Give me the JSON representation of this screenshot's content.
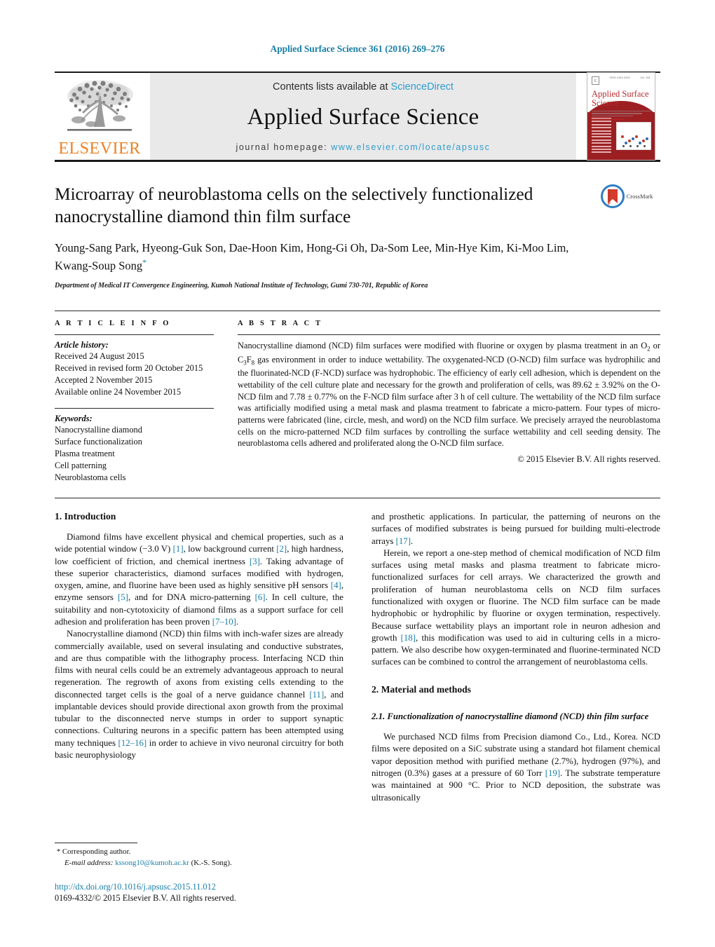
{
  "running_head": "Applied Surface Science 361 (2016) 269–276",
  "masthead": {
    "publisher_name": "ELSEVIER",
    "contents_prefix": "Contents lists available at",
    "contents_link": "ScienceDirect",
    "journal_title": "Applied Surface Science",
    "homepage_prefix": "journal homepage:",
    "homepage_url": "www.elsevier.com/locate/apsusc",
    "cover": {
      "journal_name": "Applied Surface Science",
      "top_left_code": "ISSN 0169-4332",
      "top_right_code": "Vol. 361"
    }
  },
  "article": {
    "title": "Microarray of neuroblastoma cells on the selectively functionalized nanocrystalline diamond thin film surface",
    "authors": "Young-Sang Park, Hyeong-Guk Son, Dae-Hoon Kim, Hong-Gi Oh, Da-Som Lee, Min-Hye Kim, Ki-Moo Lim, Kwang-Soup Song",
    "corresponding_marker": "*",
    "affiliation": "Department of Medical IT Convergence Engineering, Kumoh National Institute of Technology, Gumi 730-701, Republic of Korea",
    "crossmark_label": "CrossMark"
  },
  "info": {
    "heading": "A R T I C L E   I N F O",
    "history_label": "Article history:",
    "history": [
      "Received 24 August 2015",
      "Received in revised form 20 October 2015",
      "Accepted 2 November 2015",
      "Available online 24 November 2015"
    ],
    "keywords_label": "Keywords:",
    "keywords": [
      "Nanocrystalline diamond",
      "Surface functionalization",
      "Plasma treatment",
      "Cell patterning",
      "Neuroblastoma cells"
    ]
  },
  "abstract": {
    "heading": "A B S T R A C T",
    "text": "Nanocrystalline diamond (NCD) film surfaces were modified with fluorine or oxygen by plasma treatment in an O2 or C3F8 gas environment in order to induce wettability. The oxygenated-NCD (O-NCD) film surface was hydrophilic and the fluorinated-NCD (F-NCD) surface was hydrophobic. The efficiency of early cell adhesion, which is dependent on the wettability of the cell culture plate and necessary for the growth and proliferation of cells, was 89.62 ± 3.92% on the O-NCD film and 7.78 ± 0.77% on the F-NCD film surface after 3 h of cell culture. The wettability of the NCD film surface was artificially modified using a metal mask and plasma treatment to fabricate a micro-pattern. Four types of micro-patterns were fabricated (line, circle, mesh, and word) on the NCD film surface. We precisely arrayed the neuroblastoma cells on the micro-patterned NCD film surfaces by controlling the surface wettability and cell seeding density. The neuroblastoma cells adhered and proliferated along the O-NCD film surface.",
    "copyright": "© 2015 Elsevier B.V. All rights reserved."
  },
  "body": {
    "left": {
      "section_heading": "1.  Introduction",
      "paragraph1": "Diamond films have excellent physical and chemical properties, such as a wide potential window (−3.0 V) [1], low background current [2], high hardness, low coefficient of friction, and chemical inertness [3]. Taking advantage of these superior characteristics, diamond surfaces modified with hydrogen, oxygen, amine, and fluorine have been used as highly sensitive pH sensors [4], enzyme sensors [5], and for DNA micro-patterning [6]. In cell culture, the suitability and non-cytotoxicity of diamond films as a support surface for cell adhesion and proliferation has been proven [7–10].",
      "paragraph2": "Nanocrystalline diamond (NCD) thin films with inch-wafer sizes are already commercially available, used on several insulating and conductive substrates, and are thus compatible with the lithography process. Interfacing NCD thin films with neural cells could be an extremely advantageous approach to neural regeneration. The regrowth of axons from existing cells extending to the disconnected target cells is the goal of a nerve guidance channel [11], and implantable devices should provide directional axon growth from the proximal tubular to the disconnected nerve stumps in order to support synaptic connections. Culturing neurons in a specific pattern has been attempted using many techniques [12–16] in order to achieve in vivo neuronal circuitry for both basic neurophysiology"
    },
    "right": {
      "paragraph1": "and prosthetic applications. In particular, the patterning of neurons on the surfaces of modified substrates is being pursued for building multi-electrode arrays [17].",
      "paragraph2": "Herein, we report a one-step method of chemical modification of NCD film surfaces using metal masks and plasma treatment to fabricate micro-functionalized surfaces for cell arrays. We characterized the growth and proliferation of human neuroblastoma cells on NCD film surfaces functionalized with oxygen or fluorine. The NCD film surface can be made hydrophobic or hydrophilic by fluorine or oxygen termination, respectively. Because surface wettability plays an important role in neuron adhesion and growth [18], this modification was used to aid in culturing cells in a micro-pattern. We also describe how oxygen-terminated and fluorine-terminated NCD surfaces can be combined to control the arrangement of neuroblastoma cells.",
      "section_heading": "2.  Material and methods",
      "subsection_heading": "2.1.  Functionalization of nanocrystalline diamond (NCD) thin film surface",
      "paragraph3": "We purchased NCD films from Precision diamond Co., Ltd., Korea. NCD films were deposited on a SiC substrate using a standard hot filament chemical vapor deposition method with purified methane (2.7%), hydrogen (97%), and nitrogen (0.3%) gases at a pressure of 60 Torr [19]. The substrate temperature was maintained at 900 °C. Prior to NCD deposition, the substrate was ultrasonically"
    }
  },
  "footnotes": {
    "corresponding_marker": "*",
    "corresponding_text": "Corresponding author.",
    "email_label": "E-mail address:",
    "email": "kssong10@kumoh.ac.kr",
    "email_suffix": "(K.-S. Song).",
    "doi": "http://dx.doi.org/10.1016/j.apsusc.2015.11.012",
    "issn_line": "0169-4332/© 2015 Elsevier B.V. All rights reserved."
  },
  "colors": {
    "link": "#1a7fa8",
    "sciencedirect": "#2f9ccc",
    "elsevier_orange": "#f08020",
    "cover_red": "#9c1f22"
  }
}
